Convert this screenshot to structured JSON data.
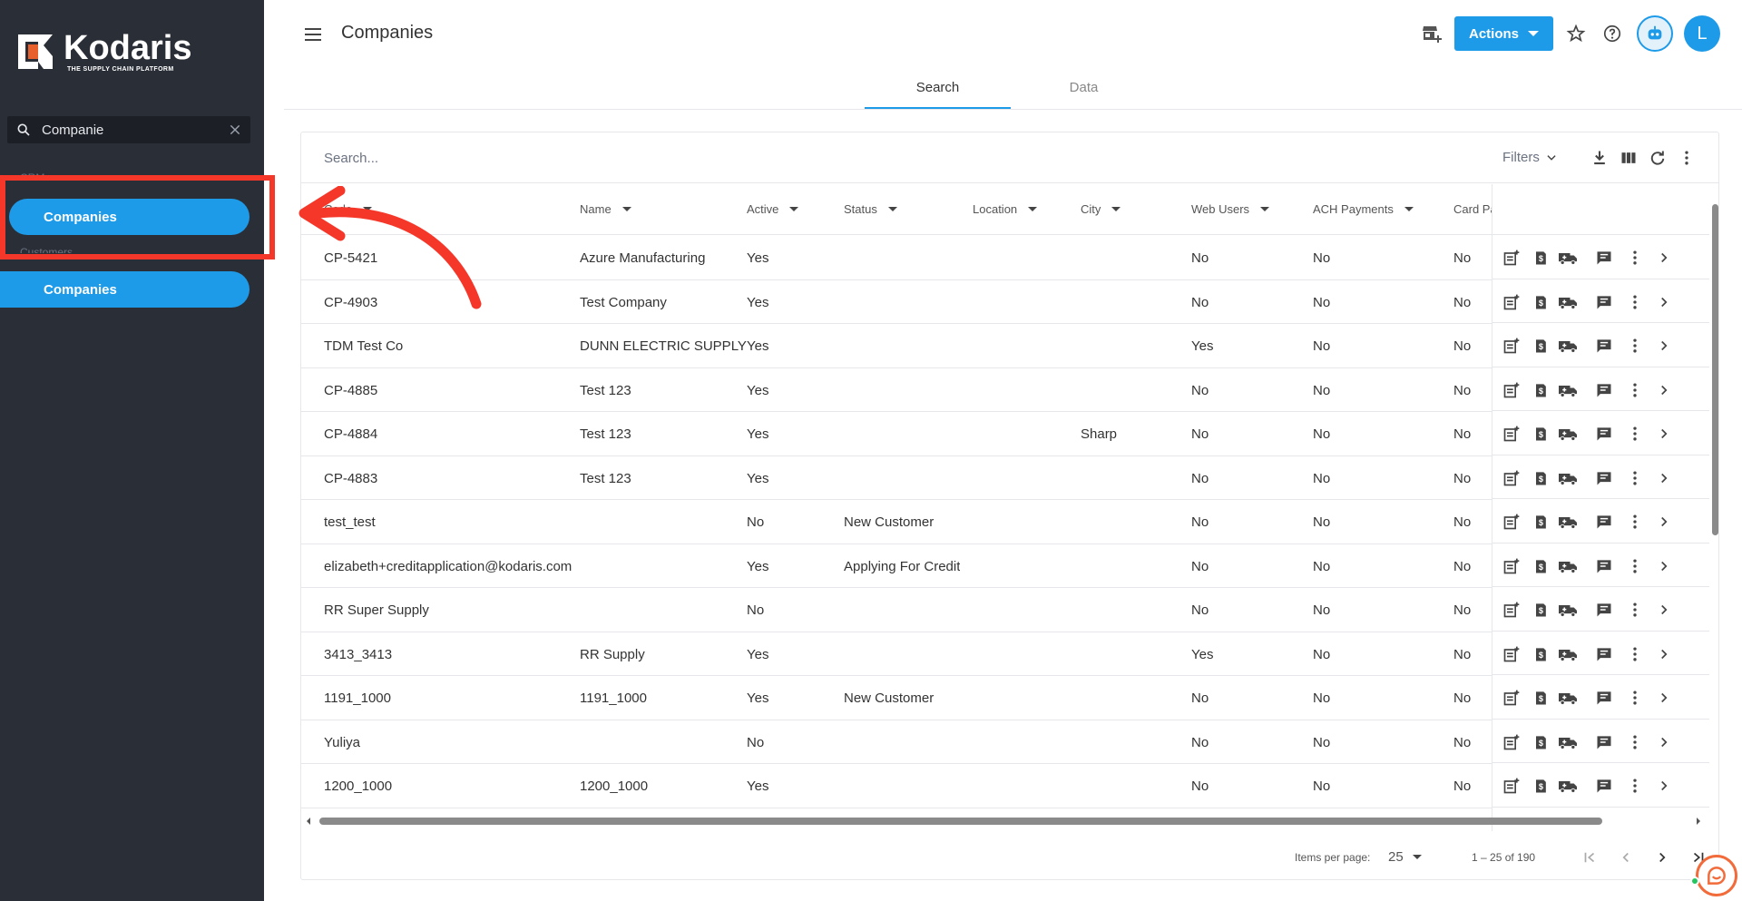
{
  "app": {
    "logo_name": "Kodaris",
    "logo_tagline": "THE SUPPLY CHAIN PLATFORM"
  },
  "sidebar": {
    "search_value": "Companie",
    "group1_label": "CRM",
    "group1_item": "Companies",
    "group2_label": "Customers",
    "group2_item": "Companies"
  },
  "header": {
    "title": "Companies",
    "actions_label": "Actions",
    "avatar_initial": "L"
  },
  "tabs": [
    {
      "label": "Search",
      "active": true
    },
    {
      "label": "Data",
      "active": false
    }
  ],
  "toolbar": {
    "search_placeholder": "Search...",
    "filters_label": "Filters"
  },
  "table": {
    "columns": [
      "Code",
      "Name",
      "Active",
      "Status",
      "Location",
      "City",
      "Web Users",
      "ACH Payments",
      "Card Pa"
    ],
    "rows": [
      [
        "CP-5421",
        "Azure Manufacturing",
        "Yes",
        "",
        "",
        "",
        "No",
        "No",
        "No"
      ],
      [
        "CP-4903",
        "Test Company",
        "Yes",
        "",
        "",
        "",
        "No",
        "No",
        "No"
      ],
      [
        "TDM Test Co",
        "DUNN ELECTRIC SUPPLY",
        "Yes",
        "",
        "",
        "",
        "Yes",
        "No",
        "No"
      ],
      [
        "CP-4885",
        "Test 123",
        "Yes",
        "",
        "",
        "",
        "No",
        "No",
        "No"
      ],
      [
        "CP-4884",
        "Test 123",
        "Yes",
        "",
        "",
        "Sharp",
        "No",
        "No",
        "No"
      ],
      [
        "CP-4883",
        "Test 123",
        "Yes",
        "",
        "",
        "",
        "No",
        "No",
        "No"
      ],
      [
        "test_test",
        "",
        "No",
        "New Customer",
        "",
        "",
        "No",
        "No",
        "No"
      ],
      [
        "elizabeth+creditapplication@kodaris.com",
        "",
        "Yes",
        "Applying For Credit",
        "",
        "",
        "No",
        "No",
        "No"
      ],
      [
        "RR Super Supply",
        "",
        "No",
        "",
        "",
        "",
        "No",
        "No",
        "No"
      ],
      [
        "3413_3413",
        "RR Supply",
        "Yes",
        "",
        "",
        "",
        "Yes",
        "No",
        "No"
      ],
      [
        "1191_1000",
        "1191_1000",
        "Yes",
        "New Customer",
        "",
        "",
        "No",
        "No",
        "No"
      ],
      [
        "Yuliya",
        "",
        "No",
        "",
        "",
        "",
        "No",
        "No",
        "No"
      ],
      [
        "1200_1000",
        "1200_1000",
        "Yes",
        "",
        "",
        "",
        "No",
        "No",
        "No"
      ]
    ]
  },
  "pagination": {
    "items_per_page_label": "Items per page:",
    "page_size": "25",
    "range_label": "1 – 25 of 190"
  },
  "colors": {
    "accent": "#1e9be8",
    "sidebar_bg": "#2a2e37",
    "annotation_red": "#f5372a"
  }
}
